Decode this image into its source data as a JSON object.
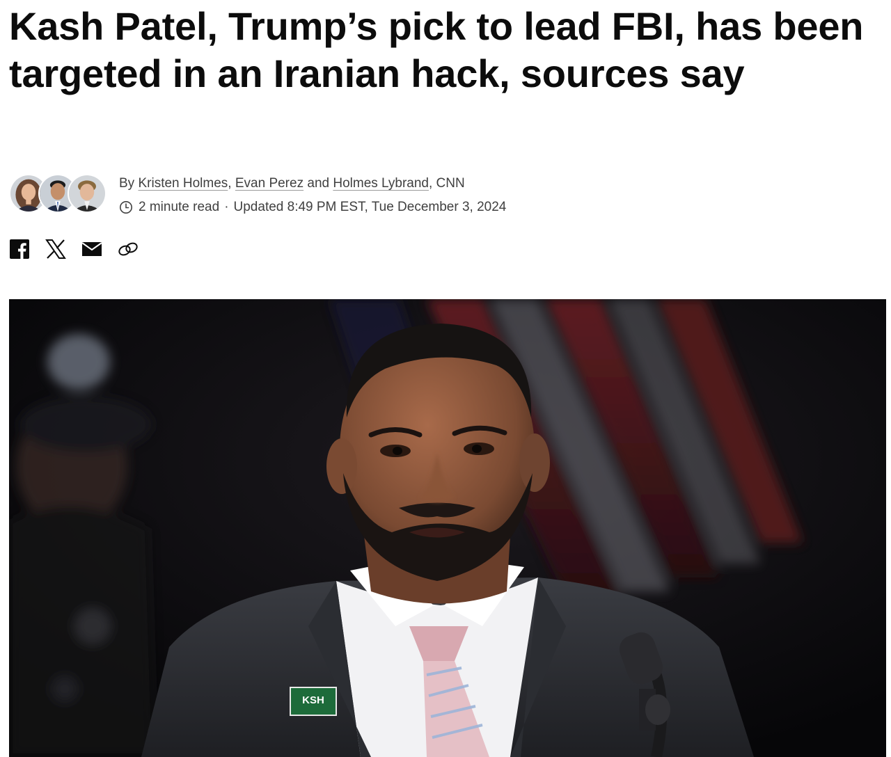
{
  "article": {
    "headline": "Kash Patel, Trump’s pick to lead FBI, has been targeted in an Iranian hack, sources say",
    "byline": {
      "prefix": "By",
      "authors": [
        "Kristen Holmes",
        "Evan Perez",
        "Holmes Lybrand"
      ],
      "separator1": ",",
      "conjunction": "and",
      "outlet_suffix": ", CNN"
    },
    "meta": {
      "read_time": "2 minute read",
      "separator": "·",
      "updated": "Updated 8:49 PM EST, Tue December 3, 2024"
    },
    "share_icons": [
      "facebook-icon",
      "x-icon",
      "email-icon",
      "link-icon"
    ],
    "hero_image": {
      "badge_text": "KSH"
    }
  },
  "colors": {
    "text": "#0c0c0c",
    "meta_text": "#404040",
    "hero_background": "#0a0a0c",
    "badge_green": "#1d6b3a"
  }
}
